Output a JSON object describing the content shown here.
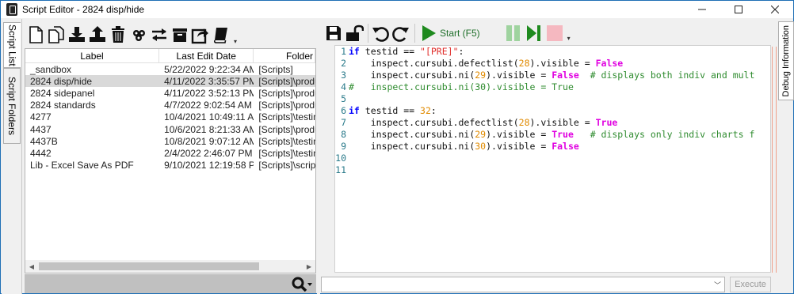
{
  "window": {
    "title": "Script Editor - 2824 disp/hide",
    "controls": [
      "minimize",
      "maximize",
      "close"
    ]
  },
  "left_tabs": [
    {
      "label": "Script List",
      "active": true
    },
    {
      "label": "Script Folders",
      "active": false
    }
  ],
  "left_toolbar": {
    "icons": [
      "new-file-icon",
      "copy-icon",
      "download-icon",
      "upload-icon",
      "trash-icon",
      "users-icon",
      "swap-icon",
      "archive-icon",
      "share-icon",
      "book-icon"
    ]
  },
  "script_list": {
    "columns": [
      "Label",
      "Last Edit Date",
      "Folder"
    ],
    "rows": [
      {
        "label": "_sandbox",
        "date": "5/22/2022 9:22:34 AM",
        "folder": "[Scripts]",
        "selected": false
      },
      {
        "label": "2824 disp/hide",
        "date": "4/11/2022 3:35:57 PM",
        "folder": "[Scripts]\\produ",
        "selected": true
      },
      {
        "label": "2824 sidepanel",
        "date": "4/11/2022 3:52:13 PM",
        "folder": "[Scripts]\\produ",
        "selected": false
      },
      {
        "label": "2824 standards",
        "date": "4/7/2022 9:02:54 AM",
        "folder": "[Scripts]\\produ",
        "selected": false
      },
      {
        "label": "4277",
        "date": "10/4/2021 10:49:11 AM",
        "folder": "[Scripts]\\testin",
        "selected": false
      },
      {
        "label": "4437",
        "date": "10/6/2021 8:21:33 AM",
        "folder": "[Scripts]\\produ",
        "selected": false
      },
      {
        "label": "4437B",
        "date": "10/8/2021 9:07:12 AM",
        "folder": "[Scripts]\\testin",
        "selected": false
      },
      {
        "label": "4442",
        "date": "2/4/2022 2:46:07 PM",
        "folder": "[Scripts]\\testin",
        "selected": false
      },
      {
        "label": "Lib - Excel Save As PDF",
        "date": "9/10/2021 12:19:58 PM",
        "folder": "[Scripts]\\script",
        "selected": false
      }
    ]
  },
  "right_toolbar": {
    "start_label": "Start (F5)"
  },
  "editor": {
    "line_numbers": [
      "1",
      "2",
      "3",
      "4",
      "5",
      "6",
      "7",
      "8",
      "9",
      "10",
      "11"
    ]
  },
  "command_bar": {
    "execute_label": "Execute"
  },
  "right_tab": {
    "label": "Debug Information"
  }
}
